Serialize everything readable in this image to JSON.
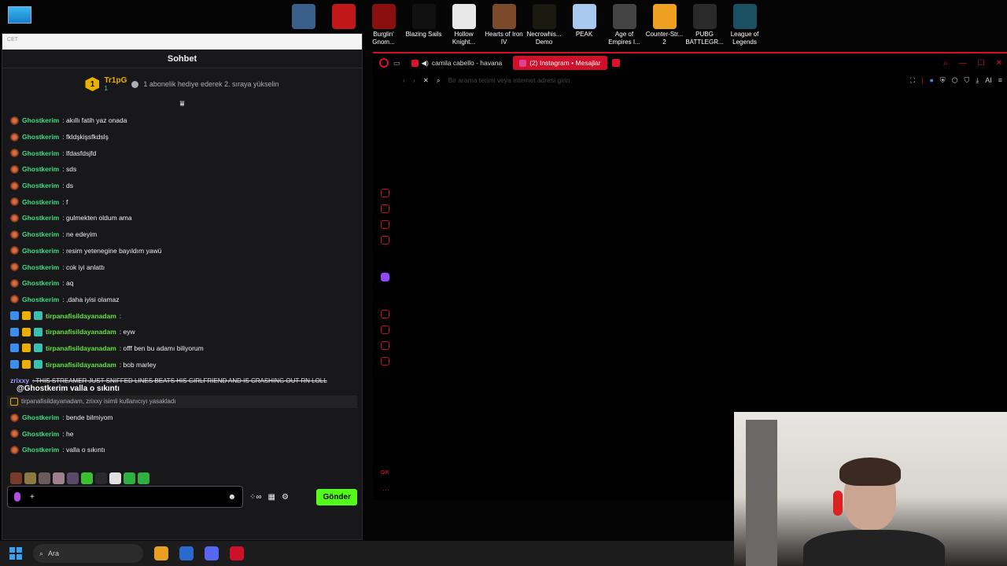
{
  "desktop": {
    "icons": [
      {
        "label": "",
        "color": "#3a5f8a"
      },
      {
        "label": "",
        "color": "#c01818"
      },
      {
        "label": "Burglin' Gnom...",
        "color": "#8a1010"
      },
      {
        "label": "Blazing Sails",
        "color": "#111111"
      },
      {
        "label": "Hollow Knight...",
        "color": "#e8e8e8"
      },
      {
        "label": "Hearts of Iron IV",
        "color": "#7a4a2a"
      },
      {
        "label": "Necrowhis... Demo",
        "color": "#1a1a10"
      },
      {
        "label": "PEAK",
        "color": "#a8c8f0"
      },
      {
        "label": "Age of Empires I...",
        "color": "#444444"
      },
      {
        "label": "Counter-Str... 2",
        "color": "#f0a020"
      },
      {
        "label": "PUBG BATTLEGR...",
        "color": "#2a2a2a"
      },
      {
        "label": "League of Legends",
        "color": "#1a5060"
      }
    ]
  },
  "chat": {
    "strip_label": "CET",
    "title": "Sohbet",
    "leader_rank": "1",
    "leader_name": "Tr1pG",
    "leader_count": "1",
    "leader_subtext": "1 abonelik hediye ederek 2. sıraya yükselin",
    "messages": [
      {
        "user": "Ghostkerim",
        "text": ": akıllı fatih yaz onada",
        "type": "g"
      },
      {
        "user": "Ghostkerim",
        "text": ": fkldşkişsfkdslş",
        "type": "g"
      },
      {
        "user": "Ghostkerim",
        "text": ": lfdasfdsjfd",
        "type": "g"
      },
      {
        "user": "Ghostkerim",
        "text": ": sds",
        "type": "g"
      },
      {
        "user": "Ghostkerim",
        "text": ": ds",
        "type": "g"
      },
      {
        "user": "Ghostkerim",
        "text": ": f",
        "type": "g"
      },
      {
        "user": "Ghostkerim",
        "text": ": gulmekten oldum ama",
        "type": "g"
      },
      {
        "user": "Ghostkerim",
        "text": ": ne edeyim",
        "type": "g"
      },
      {
        "user": "Ghostkerim",
        "text": ": resim yetenegine bayıldım yawü",
        "type": "g"
      },
      {
        "user": "Ghostkerim",
        "text": ": cok iyi anlattı",
        "type": "g"
      },
      {
        "user": "Ghostkerim",
        "text": ": aq",
        "type": "g"
      },
      {
        "user": "Ghostkerim",
        "text": ": ,daha iyisi olamaz",
        "type": "g"
      },
      {
        "user": "tirpanafisildayanadam",
        "text": ":",
        "type": "t"
      },
      {
        "user": "tirpanafisildayanadam",
        "text": ": eyw",
        "type": "t"
      },
      {
        "user": "tirpanafisildayanadam",
        "text": ": offf ben bu adamı biliyorum",
        "type": "t"
      },
      {
        "user": "tirpanafisildayanadam",
        "text": ": bob marley",
        "type": "t"
      }
    ],
    "struck_user": "zrixxy",
    "struck_text": ": THIS STREAMER JUST SNIFFED LINES BEATS HIS GIRLFRIEND AND IS CRASHING OUT RN LOLL",
    "overlay_text": "@Ghostkerim valla o sıkıntı",
    "ban_text": "tirpanafisildayanadam, zrixxy isimli kullanıcıyı yasakladı",
    "messages2": [
      {
        "user": "Ghostkerim",
        "text": ": bende bilmiyom"
      },
      {
        "user": "Ghostkerim",
        "text": ": he"
      },
      {
        "user": "Ghostkerim",
        "text": ": valla o sıkıntı"
      }
    ],
    "input_placeholder": "+",
    "send_label": "Gönder",
    "emote_colors": [
      "#7a3a2a",
      "#8a7a40",
      "#6a5a5a",
      "#a08090",
      "#5a4a6a",
      "#3ac030",
      "#2a2a2a",
      "#e0e0e0",
      "#30b040",
      "#30b040"
    ]
  },
  "browser": {
    "tabs": [
      {
        "label": "camila cabello - havana",
        "active": false,
        "fav_color": "#e0102a"
      },
      {
        "label": "(2) Instagram • Mesajlar",
        "active": true,
        "fav_color": "#e04090"
      }
    ],
    "address_placeholder": "Bir arama terimi veya internet adresi girin",
    "ai_label": "AI",
    "gx_label": "GX"
  },
  "taskbar": {
    "search_label": "Ara",
    "apps": [
      "#e8a020",
      "#2a6ad0",
      "#5865f2",
      "#d0102a"
    ]
  }
}
